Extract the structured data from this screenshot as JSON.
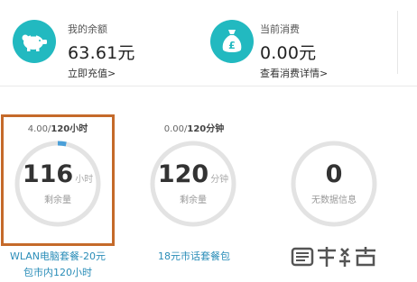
{
  "balance": {
    "label": "我的余额",
    "amount": "63.61元",
    "link": "立即充值>"
  },
  "consumption": {
    "label": "当前消费",
    "amount": "0.00元",
    "link": "查看消费详情>"
  },
  "packages": [
    {
      "used": "4.00/",
      "total": "120小时",
      "remaining_value": "116",
      "remaining_unit": "小时",
      "remaining_label": "剩余量",
      "name_line1": "WLAN电脑套餐-20元",
      "name_line2": "包市内120小时",
      "progress_used_fraction": 0.033,
      "highlighted": true
    },
    {
      "used": "0.00/",
      "total": "120分钟",
      "remaining_value": "120",
      "remaining_unit": "分钟",
      "remaining_label": "剩余量",
      "name_line1": "18元市话套餐包",
      "name_line2": "",
      "progress_used_fraction": 0,
      "highlighted": false
    },
    {
      "used": "",
      "total": "",
      "remaining_value": "0",
      "remaining_unit": "",
      "remaining_label": "无数据信息",
      "name_line1": "",
      "name_line2": "",
      "progress_used_fraction": 0,
      "highlighted": false
    }
  ],
  "colors": {
    "accent": "#22b9c0",
    "ring_bg": "#e3e3e3",
    "ring_progress": "#4a9fd8",
    "highlight": "#c56a2a",
    "link": "#2a8db8"
  },
  "icons": [
    "piggy-bank-icon",
    "money-bag-icon",
    "watermark-logo"
  ]
}
